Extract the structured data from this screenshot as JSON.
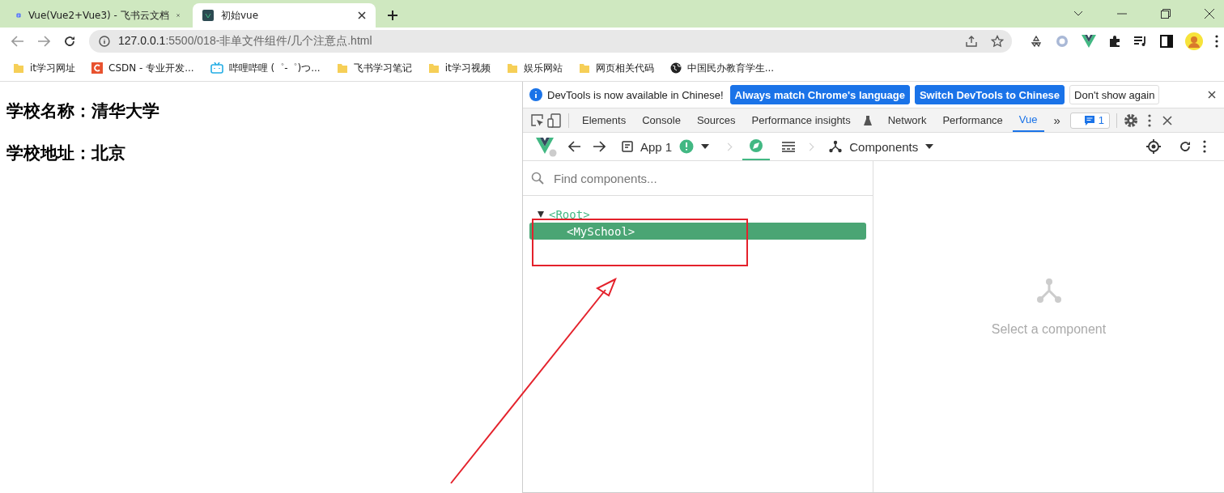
{
  "browser_tabs": [
    {
      "title": "Vue(Vue2+Vue3) - 飞书云文档",
      "selected": false,
      "kind": "doc"
    },
    {
      "title": "初始vue",
      "selected": true,
      "kind": "vue"
    }
  ],
  "address_bar": {
    "host": "127.0.0.1",
    "path": ":5500/018-非单文件组件/几个注意点.html"
  },
  "bookmarks": [
    {
      "label": "it学习网址",
      "kind": "folder"
    },
    {
      "label": "CSDN - 专业开发...",
      "kind": "csdn"
    },
    {
      "label": "哔哩哔哩 (゜-゜)つ...",
      "kind": "bili"
    },
    {
      "label": "飞书学习笔记",
      "kind": "folder"
    },
    {
      "label": "it学习视频",
      "kind": "folder"
    },
    {
      "label": "娱乐网站",
      "kind": "folder"
    },
    {
      "label": "网页相关代码",
      "kind": "folder"
    },
    {
      "label": "中国民办教育学生...",
      "kind": "globe"
    }
  ],
  "page": {
    "lines": [
      "学校名称：清华大学",
      "学校地址：北京"
    ]
  },
  "devtools": {
    "infobar": {
      "message": "DevTools is now available in Chinese!",
      "buttons": [
        {
          "label": "Always match Chrome's language",
          "kind": "primary"
        },
        {
          "label": "Switch DevTools to Chinese",
          "kind": "primary"
        },
        {
          "label": "Don't show again",
          "kind": "plain"
        }
      ]
    },
    "tabs": [
      {
        "label": "Elements",
        "selected": false
      },
      {
        "label": "Console",
        "selected": false
      },
      {
        "label": "Sources",
        "selected": false
      },
      {
        "label": "Performance insights",
        "selected": false
      },
      {
        "label": "Network",
        "selected": false
      },
      {
        "label": "Performance",
        "selected": false
      },
      {
        "label": "Vue",
        "selected": true
      }
    ],
    "overflow": "»",
    "issues_count": "1",
    "vue_toolbar": {
      "app": "App 1",
      "view": "Components"
    },
    "search": {
      "placeholder": "Find components..."
    },
    "tree": [
      {
        "name": "<Root>",
        "expanded": true,
        "selected": false,
        "children": [
          {
            "name": "<MySchool>",
            "selected": true
          }
        ]
      }
    ],
    "empty_state": "Select a component"
  }
}
